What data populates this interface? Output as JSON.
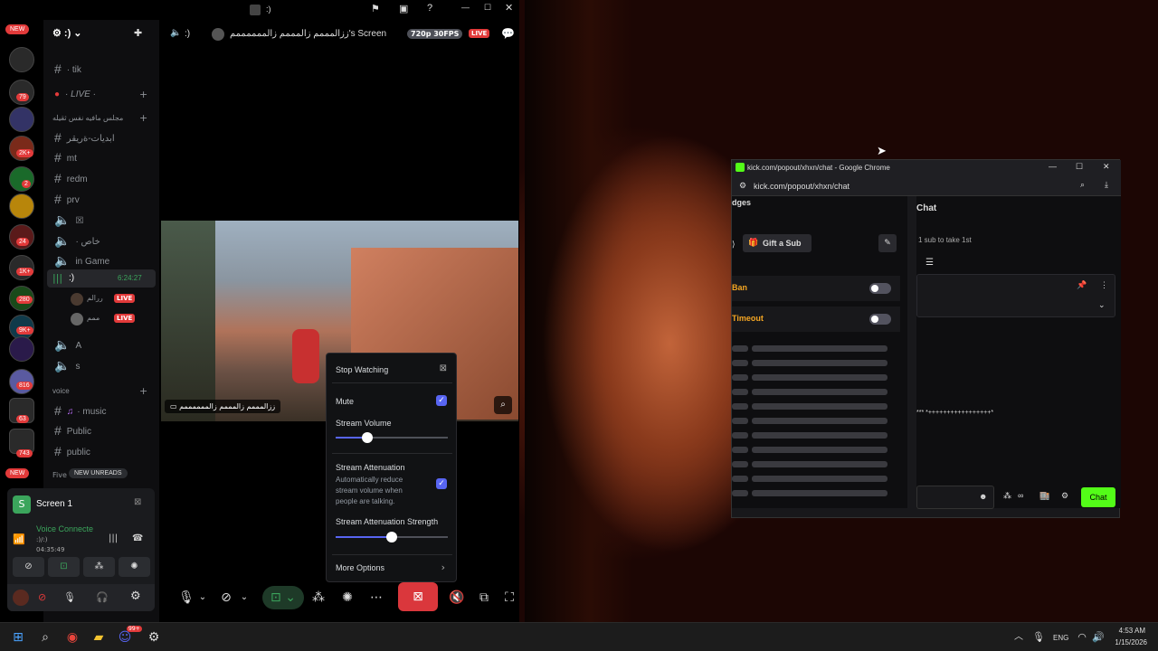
{
  "discord": {
    "window_title": ":)",
    "server_name": ":)",
    "stream_header": {
      "channel": ":)",
      "streamer": "ززالمممم زالمممم زالممممممم's Screen",
      "quality": "720p 30FPS",
      "live": "LIVE"
    },
    "badges": {
      "new_top": "NEW",
      "b1": "79",
      "b2": "2K+",
      "b3": "2",
      "b4": "24",
      "b5": "1K+",
      "b6": "280",
      "b7": "9K+",
      "b8": "816",
      "b9": "63",
      "b10": "743",
      "new_bottom": "NEW"
    },
    "channels": [
      {
        "icon": "#",
        "name": "· tik"
      },
      {
        "icon": "●",
        "name": "· LIVE ·"
      },
      {
        "icon": "cat",
        "name": "مجلس مافيه نفس ثقيله"
      },
      {
        "icon": "#",
        "name": "ابديات-ةريقر"
      },
      {
        "icon": "#",
        "name": "mt"
      },
      {
        "icon": "#",
        "name": "redm"
      },
      {
        "icon": "#",
        "name": "prv"
      },
      {
        "icon": "spk",
        "name": "☒"
      },
      {
        "icon": "spk",
        "name": "· خاص"
      },
      {
        "icon": "spk",
        "name": "in Game"
      },
      {
        "icon": "spk",
        "name": ":)",
        "time": "6:24:27"
      },
      {
        "icon": "user",
        "name": "ررالم",
        "live": "LIVE"
      },
      {
        "icon": "user",
        "name": "ممم",
        "live": "LIVE"
      },
      {
        "icon": "spk",
        "name": "A"
      },
      {
        "icon": "spk",
        "name": "s"
      },
      {
        "icon": "cat",
        "name": "voice"
      },
      {
        "icon": "#",
        "name": "· music"
      },
      {
        "icon": "#",
        "name": "Public"
      },
      {
        "icon": "#",
        "name": "public"
      }
    ],
    "new_unreads": "NEW UNREADS",
    "five_label": "Five",
    "voice_panel": {
      "app": "Screen 1",
      "status": "Voice Connecte",
      "channel": ":)/:)",
      "timer": "04:35:49"
    },
    "video_caption": "ززالمممم زالمممم زالممممممم",
    "popup": {
      "stop_watching": "Stop Watching",
      "mute": "Mute",
      "stream_volume": "Stream Volume",
      "stream_volume_level": 0.28,
      "attenuation": "Stream Attenuation",
      "attenuation_desc": "Automatically reduce stream volume when people are talking.",
      "attenuation_strength": "Stream Attenuation Strength",
      "attenuation_strength_level": 0.5,
      "more_options": "More Options"
    }
  },
  "chrome": {
    "title": "kick.com/popout/xhxn/chat - Google Chrome",
    "url": "kick.com/popout/xhxn/chat",
    "badges_heading": "dges",
    "gift_sub": "Gift a Sub",
    "ban": "Ban",
    "timeout": "Timeout",
    "chat_heading": "Chat",
    "sub_note": "1 sub to take 1st",
    "chat_message": "*** *+++++++++++++++++*",
    "chat_button": "Chat"
  },
  "taskbar": {
    "lang": "ENG",
    "time": "4:53 AM",
    "date": "1/15/2026",
    "discord_badge": "99+"
  }
}
